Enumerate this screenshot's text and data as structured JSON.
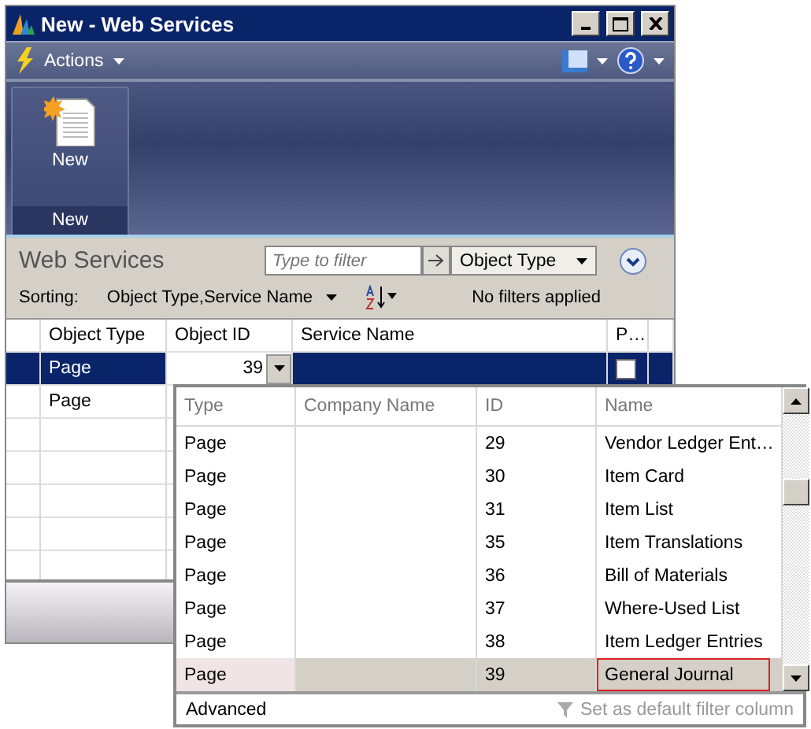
{
  "window": {
    "title": "New - Web Services"
  },
  "toolbar": {
    "actions_label": "Actions"
  },
  "ribbon": {
    "buttons": [
      {
        "label": "New"
      }
    ],
    "group_label": "New"
  },
  "list": {
    "title": "Web Services",
    "filter_placeholder": "Type to filter",
    "filter_field": "Object Type",
    "sorting_label": "Sorting:",
    "sorting_value": "Object Type,Service Name",
    "filter_status": "No filters applied"
  },
  "table": {
    "columns": [
      "Object Type",
      "Object ID",
      "Service Name",
      "P…"
    ],
    "rows": [
      {
        "object_type": "Page",
        "object_id": "39",
        "selected": true,
        "published": false
      },
      {
        "object_type": "Page",
        "selected": false
      }
    ]
  },
  "lookup": {
    "columns": [
      "Type",
      "Company Name",
      "ID",
      "Name"
    ],
    "rows": [
      {
        "type": "Page",
        "id": "29",
        "name": "Vendor Ledger Ent…",
        "selected": false
      },
      {
        "type": "Page",
        "id": "30",
        "name": "Item Card",
        "selected": false
      },
      {
        "type": "Page",
        "id": "31",
        "name": "Item List",
        "selected": false
      },
      {
        "type": "Page",
        "id": "35",
        "name": "Item Translations",
        "selected": false
      },
      {
        "type": "Page",
        "id": "36",
        "name": "Bill of Materials",
        "selected": false
      },
      {
        "type": "Page",
        "id": "37",
        "name": "Where-Used List",
        "selected": false
      },
      {
        "type": "Page",
        "id": "38",
        "name": "Item Ledger Entries",
        "selected": false
      },
      {
        "type": "Page",
        "id": "39",
        "name": "General Journal",
        "selected": true
      }
    ],
    "advanced_label": "Advanced",
    "default_filter_label": "Set as default filter column"
  }
}
